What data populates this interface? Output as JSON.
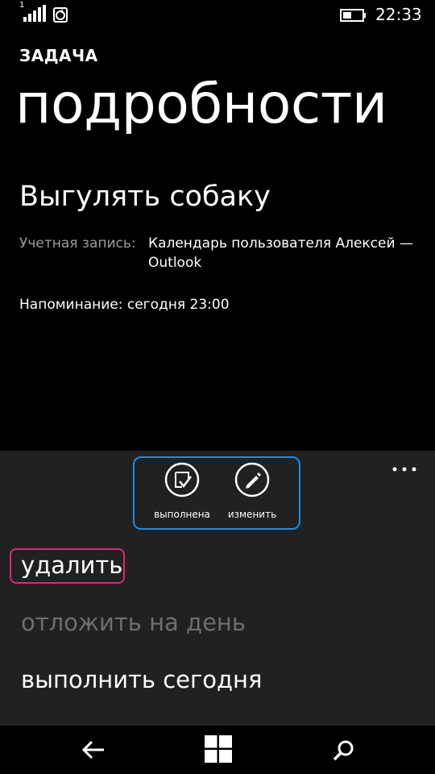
{
  "status_bar": {
    "signal_label": "1",
    "time": "22:33",
    "icons": [
      "signal-icon",
      "sync-icon",
      "battery-icon"
    ]
  },
  "header": {
    "app_title": "ЗАДАЧА",
    "page_title": "подробности"
  },
  "task": {
    "title": "Выгулять собаку",
    "account_label": "Учетная запись:",
    "account_value": "Календарь пользователя Алексей — Outlook",
    "reminder": "Напоминание: сегодня 23:00"
  },
  "app_bar": {
    "buttons": [
      {
        "label": "выполнена",
        "icon": "checkmark-note-icon"
      },
      {
        "label": "изменить",
        "icon": "pencil-icon"
      }
    ],
    "more_icon": "more-dots-icon",
    "menu_items": [
      {
        "label": "удалить",
        "enabled": true
      },
      {
        "label": "отложить на день",
        "enabled": false
      },
      {
        "label": "выполнить сегодня",
        "enabled": true
      }
    ]
  },
  "nav_bar": {
    "icons": [
      "back-arrow-icon",
      "windows-start-icon",
      "search-icon"
    ]
  },
  "colors": {
    "background": "#000000",
    "app_bar": "#212121",
    "highlight_blue": "#1a8ce6",
    "highlight_pink": "#e0257a",
    "disabled_text": "#6e6e6e",
    "secondary_text": "#9a9a9a"
  }
}
